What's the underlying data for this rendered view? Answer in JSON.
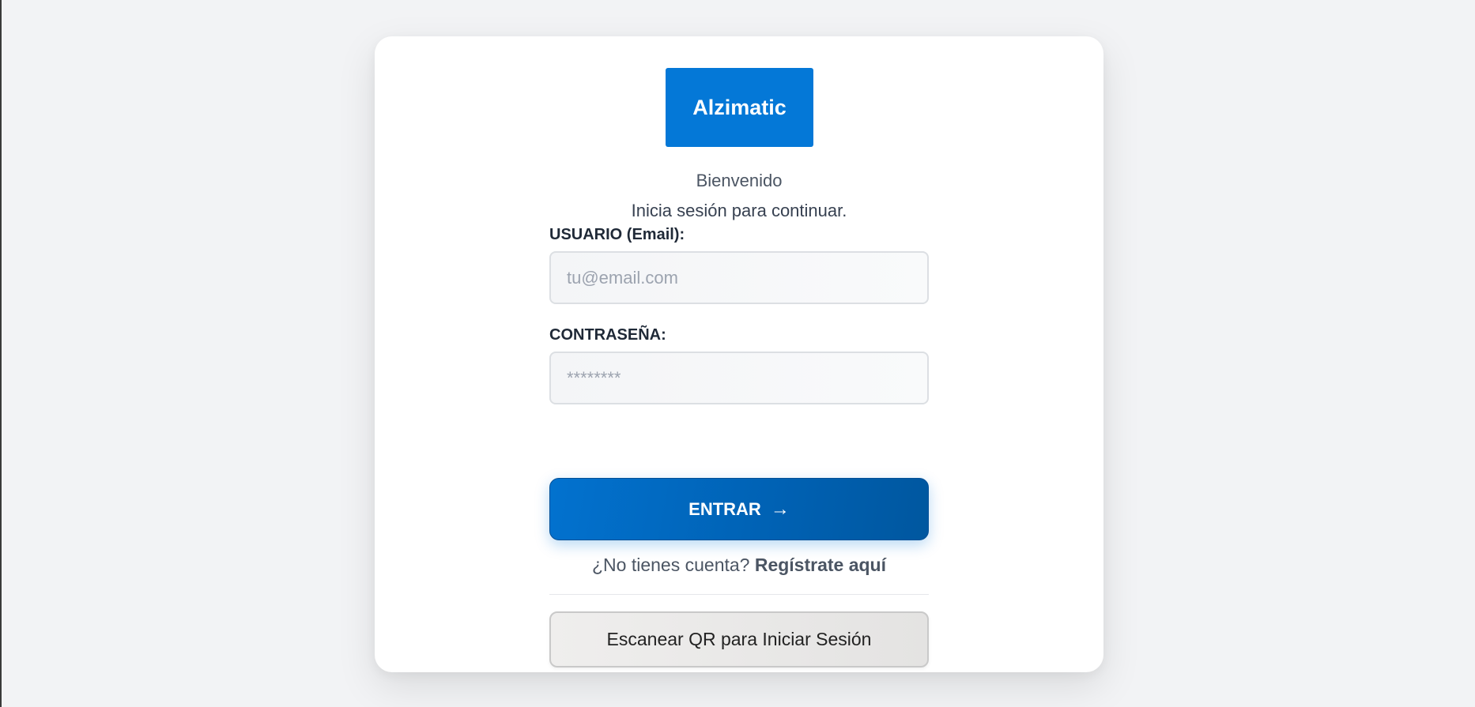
{
  "brand": {
    "logo_text": "Alzimatic",
    "accent_color": "#0478d7"
  },
  "header": {
    "welcome": "Bienvenido",
    "subtitle": "Inicia sesión para continuar."
  },
  "form": {
    "email_label": "USUARIO (Email):",
    "email_placeholder": "tu@email.com",
    "email_value": "",
    "password_label": "CONTRASEÑA:",
    "password_placeholder": "********",
    "password_value": "",
    "submit_label": "ENTRAR",
    "submit_icon": "arrow-right-icon"
  },
  "signup": {
    "prompt": "¿No tienes cuenta?",
    "link_label": "Regístrate aquí"
  },
  "qr": {
    "button_label": "Escanear QR para Iniciar Sesión"
  }
}
